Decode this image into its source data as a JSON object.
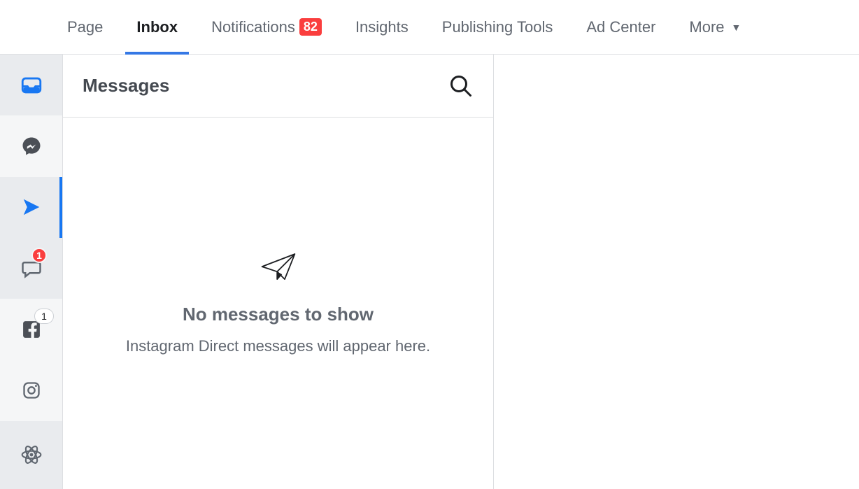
{
  "topnav": {
    "page": "Page",
    "inbox": "Inbox",
    "notifications": "Notifications",
    "notifications_badge": "82",
    "insights": "Insights",
    "publishing_tools": "Publishing Tools",
    "ad_center": "Ad Center",
    "more": "More"
  },
  "sidebar": {
    "comments_badge": "1",
    "facebook_badge": "1"
  },
  "mid": {
    "title": "Messages",
    "empty_title": "No messages to show",
    "empty_sub": "Instagram Direct messages will appear here."
  }
}
